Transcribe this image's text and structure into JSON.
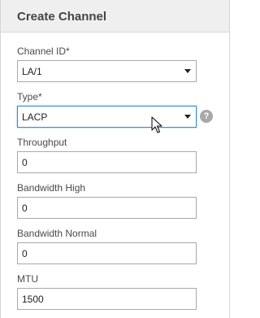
{
  "dialog": {
    "title": "Create Channel"
  },
  "fields": {
    "channel_id": {
      "label": "Channel ID*",
      "value": "LA/1"
    },
    "type": {
      "label": "Type*",
      "value": "LACP"
    },
    "throughput": {
      "label": "Throughput",
      "value": "0"
    },
    "bandwidth_high": {
      "label": "Bandwidth High",
      "value": "0"
    },
    "bandwidth_normal": {
      "label": "Bandwidth Normal",
      "value": "0"
    },
    "mtu": {
      "label": "MTU",
      "value": "1500"
    }
  },
  "help": {
    "glyph": "?",
    "icon": "help-icon"
  },
  "colors": {
    "header_bg": "#efefef",
    "focus_border": "#3d8ccc"
  }
}
